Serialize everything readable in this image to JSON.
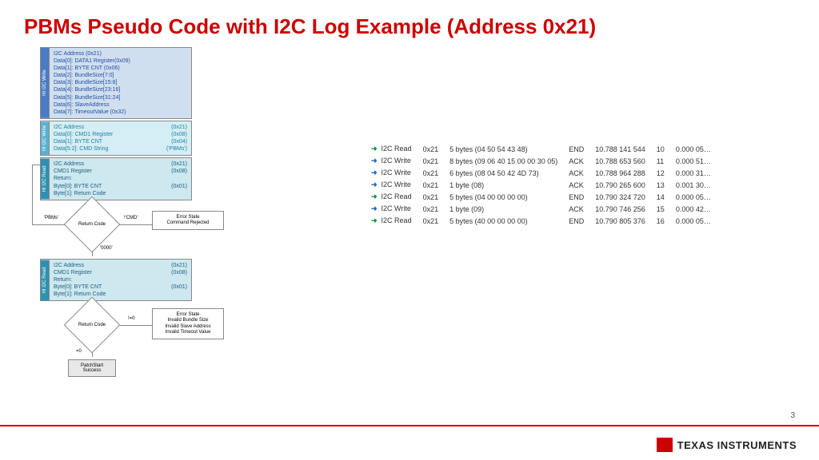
{
  "title": "PBMs Pseudo Code with I2C Log Example (Address 0x21)",
  "pageNumber": "3",
  "logoText": "TEXAS INSTRUMENTS",
  "flowchart": {
    "box1": {
      "side": "HI I2C Write",
      "lines": [
        "I2C Address (0x21)",
        "Data[0]: DATA1 Register(0x09)",
        "Data[1]: BYTE CNT (0x06)",
        "Data[2]: BundleSize[7:0]",
        "Data[3]: BundleSize[15:8]",
        "Data[4]: BundleSize[23:16]",
        "Data[5]: BundleSize[31:24]",
        "Data[6]: SlaveAddress",
        "Data[7]: TimeoutValue (0x32)"
      ]
    },
    "box2": {
      "side": "HI I2C Write",
      "lines": [
        {
          "l": "I2C Address",
          "r": "(0x21)"
        },
        {
          "l": "Data[0]: CMD1 Register",
          "r": "(0x08)"
        },
        {
          "l": "Data[1]: BYTE CNT",
          "r": "(0x04)"
        },
        {
          "l": "Data[5:2]: CMD String",
          "r": "('PBMs')"
        }
      ]
    },
    "box3": {
      "side": "HI I2C Read",
      "lines": [
        {
          "l": "I2C Address",
          "r": "(0x21)"
        },
        {
          "l": "CMD1 Register",
          "r": "(0x08)"
        },
        {
          "l": "Return:",
          "r": ""
        },
        {
          "l": "Byte[0]: BYTE CNT",
          "r": "(0x01)"
        },
        {
          "l": "Byte[1]: Return Code",
          "r": ""
        }
      ]
    },
    "decision1": {
      "label": "Return Code",
      "leftEdge": "'PBMs'",
      "rightEdge": "!'CMD'",
      "bottomEdge": "'0000'",
      "error": "Error State\nCommand Rejected"
    },
    "box4": {
      "side": "HI I2C Read",
      "lines": [
        {
          "l": "I2C Address",
          "r": "(0x21)"
        },
        {
          "l": "CMD1 Register",
          "r": "(0x08)"
        },
        {
          "l": "Return:",
          "r": ""
        },
        {
          "l": "Byte[0]: BYTE CNT",
          "r": "(0x01)"
        },
        {
          "l": "Byte[1]: Return Code",
          "r": ""
        }
      ]
    },
    "decision2": {
      "label": "Return Code",
      "rightEdge": "!=0",
      "bottomEdge": "=0",
      "error": "Error State\nInvalid Bundle Size\nInvalid Slave Address\nInvalid Timeout Value"
    },
    "success": "PatchStart\nSuccess"
  },
  "log": {
    "rows": [
      {
        "dir": "r",
        "op": "I2C Read",
        "addr": "0x21",
        "bytes": "5 bytes (04 50 54 43 48)",
        "stat": "END",
        "ts": "10.788 141 544",
        "n": "10",
        "d": "0.000 05…"
      },
      {
        "dir": "b",
        "op": "I2C Write",
        "addr": "0x21",
        "bytes": "8 bytes (09 06 40 15 00 00 30 05)",
        "stat": "ACK",
        "ts": "10.788 653 560",
        "n": "11",
        "d": "0.000 51…"
      },
      {
        "dir": "b",
        "op": "I2C Write",
        "addr": "0x21",
        "bytes": "6 bytes (08 04 50 42 4D 73)",
        "stat": "ACK",
        "ts": "10.788 964 288",
        "n": "12",
        "d": "0.000 31…"
      },
      {
        "dir": "b",
        "op": "I2C Write",
        "addr": "0x21",
        "bytes": "1 byte (08)",
        "stat": "ACK",
        "ts": "10.790 265 600",
        "n": "13",
        "d": "0.001 30…"
      },
      {
        "dir": "r",
        "op": "I2C Read",
        "addr": "0x21",
        "bytes": "5 bytes (04 00 00 00 00)",
        "stat": "END",
        "ts": "10.790 324 720",
        "n": "14",
        "d": "0.000 05…"
      },
      {
        "dir": "b",
        "op": "I2C Write",
        "addr": "0x21",
        "bytes": "1 byte (09)",
        "stat": "ACK",
        "ts": "10.790 746 256",
        "n": "15",
        "d": "0.000 42…"
      },
      {
        "dir": "r",
        "op": "I2C Read",
        "addr": "0x21",
        "bytes": "5 bytes (40 00 00 00 00)",
        "stat": "END",
        "ts": "10.790 805 376",
        "n": "16",
        "d": "0.000 05…"
      }
    ]
  }
}
